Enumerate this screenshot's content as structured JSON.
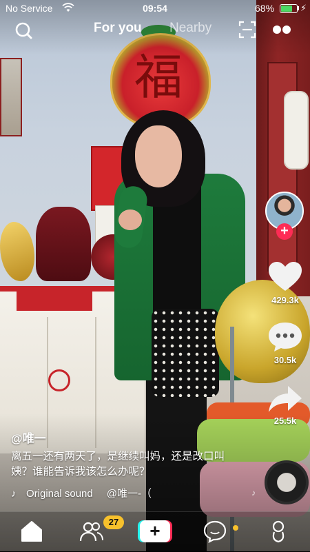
{
  "status_bar": {
    "carrier": "No Service",
    "time": "09:54",
    "battery_percent": "68%",
    "battery_level": 0.68,
    "wifi_icon": "wifi-icon",
    "charging_icon": "bolt-icon"
  },
  "top_nav": {
    "search_icon": "search-icon",
    "tabs": [
      {
        "label": "For you",
        "active": true
      },
      {
        "label": "Nearby",
        "active": false
      }
    ],
    "scan_icon": "scan-icon",
    "more_icon": "more-icon"
  },
  "video": {
    "sign_character": "福",
    "username": "@唯一",
    "caption": "离五一还有两天了，是继续叫妈，还是改口叫姨？谁能告诉我该怎么办呢？",
    "sound": {
      "title": "Original sound",
      "artist": "@唯一-（"
    }
  },
  "right_rail": {
    "follow_icon": "plus-icon",
    "like_count": "429.3k",
    "comment_count": "30.5k",
    "share_count": "25.5k",
    "music_note": "♪"
  },
  "tab_bar": {
    "home_icon": "home-icon",
    "friends_icon": "friends-icon",
    "friends_badge": "27",
    "create_label": "+",
    "inbox_icon": "inbox-icon",
    "profile_icon": "profile-icon"
  },
  "colors": {
    "accent_pink": "#fe2c55",
    "accent_cyan": "#25f4ee",
    "badge_yellow": "#f7c12c",
    "battery_green": "#4cd964"
  }
}
